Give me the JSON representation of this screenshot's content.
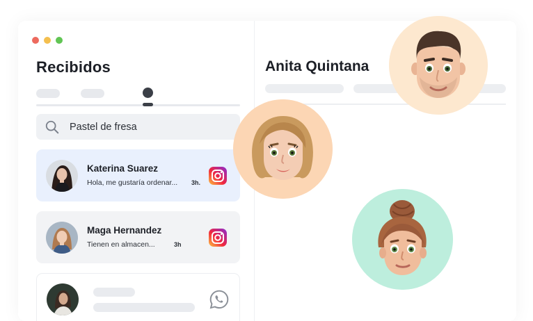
{
  "window": {
    "dots": [
      "#ed6a5e",
      "#f4bf4f",
      "#61c554"
    ]
  },
  "inbox": {
    "title": "Recibidos",
    "search": {
      "value": "Pastel de fresa",
      "icon": "search-icon"
    },
    "conversations": [
      {
        "name": "Katerina Suarez",
        "preview": "Hola, me gustaría ordenar...",
        "time": "3h.",
        "channel": "instagram-icon",
        "active": true
      },
      {
        "name": "Maga Hernandez",
        "preview": "Tienen en almacen...",
        "time": "3h",
        "channel": "instagram-icon",
        "active": false
      },
      {
        "name": "",
        "preview": "",
        "time": "",
        "channel": "whatsapp-icon",
        "active": false
      }
    ]
  },
  "chat": {
    "contact_name": "Anita Quintana"
  },
  "colors": {
    "active_card": "#e9f0fd",
    "bubble_peach": "#fde8cf",
    "bubble_orange": "#fcd6b4",
    "bubble_mint": "#bdeedd"
  }
}
